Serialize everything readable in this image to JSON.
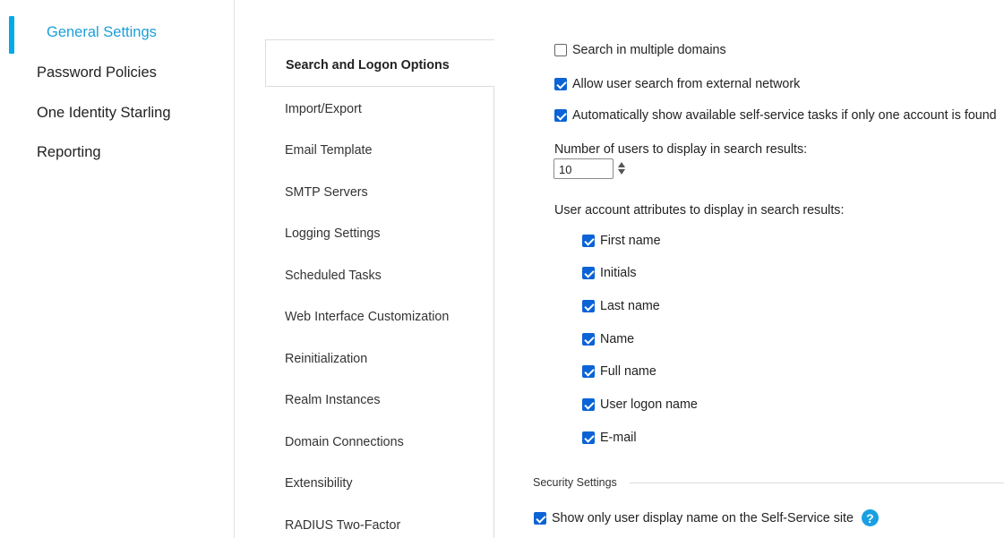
{
  "nav": {
    "items": [
      {
        "label": "General Settings",
        "active": true
      },
      {
        "label": "Password Policies",
        "active": false
      },
      {
        "label": "One Identity Starling",
        "active": false
      },
      {
        "label": "Reporting",
        "active": false
      }
    ],
    "accent_color": "#04a9e8",
    "active_color": "#1a9fd8"
  },
  "tabs": {
    "items": [
      "Search and Logon Options",
      "Import/Export",
      "Email Template",
      "SMTP Servers",
      "Logging Settings",
      "Scheduled Tasks",
      "Web Interface Customization",
      "Reinitialization",
      "Realm Instances",
      "Domain Connections",
      "Extensibility",
      "RADIUS Two-Factor"
    ],
    "active_index": 0
  },
  "options": {
    "search_multiple_domains": {
      "label": "Search in multiple domains",
      "checked": false
    },
    "allow_external_search": {
      "label": "Allow user search from external network",
      "checked": true
    },
    "auto_show_tasks": {
      "label": "Automatically show available self-service tasks if only one account is found",
      "checked": true
    },
    "num_users_label": "Number of users to display in search results:",
    "num_users_value": "10",
    "attributes_label": "User account attributes to display in search results:",
    "attributes": [
      {
        "label": "First name",
        "checked": true
      },
      {
        "label": "Initials",
        "checked": true
      },
      {
        "label": "Last name",
        "checked": true
      },
      {
        "label": "Name",
        "checked": true
      },
      {
        "label": "Full name",
        "checked": true
      },
      {
        "label": "User logon name",
        "checked": true
      },
      {
        "label": "E-mail",
        "checked": true
      }
    ]
  },
  "security": {
    "title": "Security Settings",
    "show_display_name": {
      "label": "Show only user display name on the Self-Service site",
      "checked": true
    },
    "help_icon": "question-mark-icon",
    "help_glyph": "?"
  },
  "colors": {
    "checkbox": "#0b63d6",
    "help": "#1a9fe3"
  }
}
